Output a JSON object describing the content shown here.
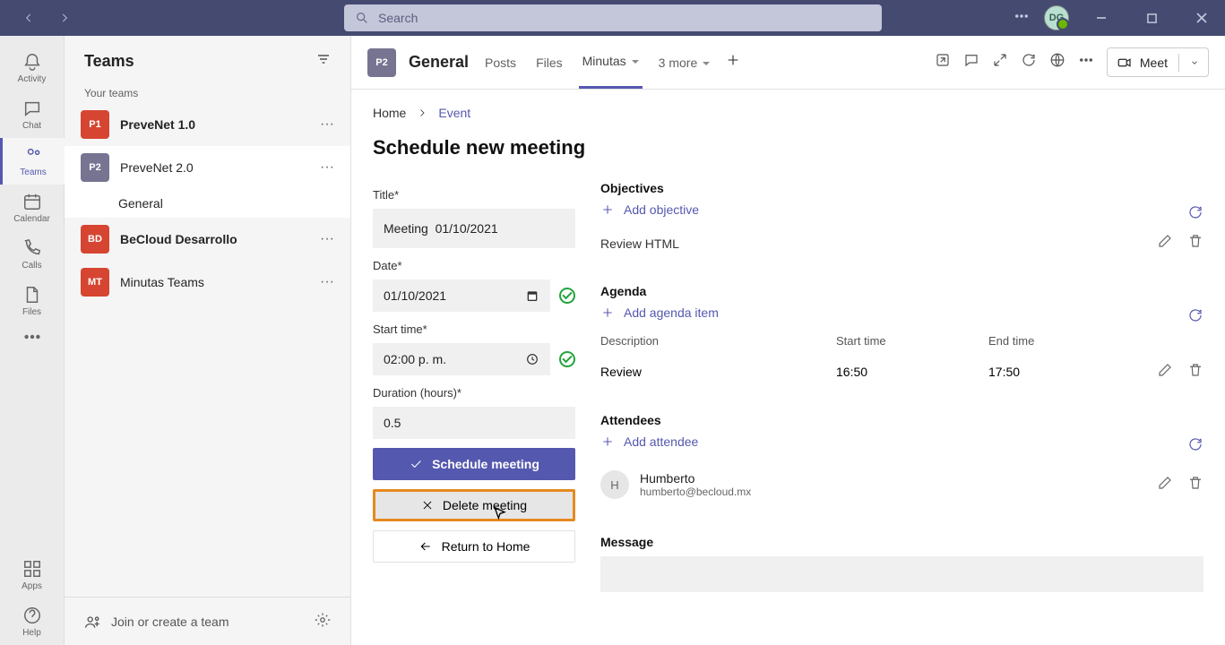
{
  "titlebar": {
    "search_placeholder": "Search",
    "avatar_initials": "DG"
  },
  "apprail": {
    "activity": "Activity",
    "chat": "Chat",
    "teams": "Teams",
    "calendar": "Calendar",
    "calls": "Calls",
    "files": "Files",
    "apps": "Apps",
    "help": "Help"
  },
  "teams_panel": {
    "title": "Teams",
    "subheading": "Your teams",
    "items": [
      {
        "badge": "P1",
        "label": "PreveNet 1.0",
        "color": "#d64531"
      },
      {
        "badge": "P2",
        "label": "PreveNet 2.0",
        "color": "#767491"
      },
      {
        "badge": "BD",
        "label": "BeCloud Desarrollo",
        "color": "#d64531"
      },
      {
        "badge": "MT",
        "label": "Minutas Teams",
        "color": "#d64531"
      }
    ],
    "channel_general": "General",
    "footer_join": "Join or create a team"
  },
  "chanhead": {
    "badge": "P2",
    "title": "General",
    "tabs": {
      "posts": "Posts",
      "files": "Files",
      "minutas": "Minutas",
      "more": "3 more"
    },
    "meet": "Meet"
  },
  "breadcrumb": {
    "home": "Home",
    "event": "Event"
  },
  "page": {
    "title": "Schedule new meeting"
  },
  "form": {
    "title_label": "Title*",
    "title_value": "Meeting  01/10/2021",
    "date_label": "Date*",
    "date_value": "01/10/2021",
    "start_label": "Start time*",
    "start_value": "02:00 p. m.",
    "duration_label": "Duration (hours)*",
    "duration_value": "0.5",
    "schedule_btn": "Schedule meeting",
    "delete_btn": "Delete meeting",
    "return_btn": "Return to Home"
  },
  "objectives": {
    "title": "Objectives",
    "add": "Add objective",
    "items": [
      {
        "text": "Review HTML"
      }
    ]
  },
  "agenda": {
    "title": "Agenda",
    "add": "Add agenda item",
    "col_desc": "Description",
    "col_start": "Start time",
    "col_end": "End time",
    "rows": [
      {
        "desc": "Review",
        "start": "16:50",
        "end": "17:50"
      }
    ]
  },
  "attendees": {
    "title": "Attendees",
    "add": "Add attendee",
    "rows": [
      {
        "initial": "H",
        "name": "Humberto",
        "email": "humberto@becloud.mx"
      }
    ]
  },
  "message": {
    "title": "Message"
  }
}
